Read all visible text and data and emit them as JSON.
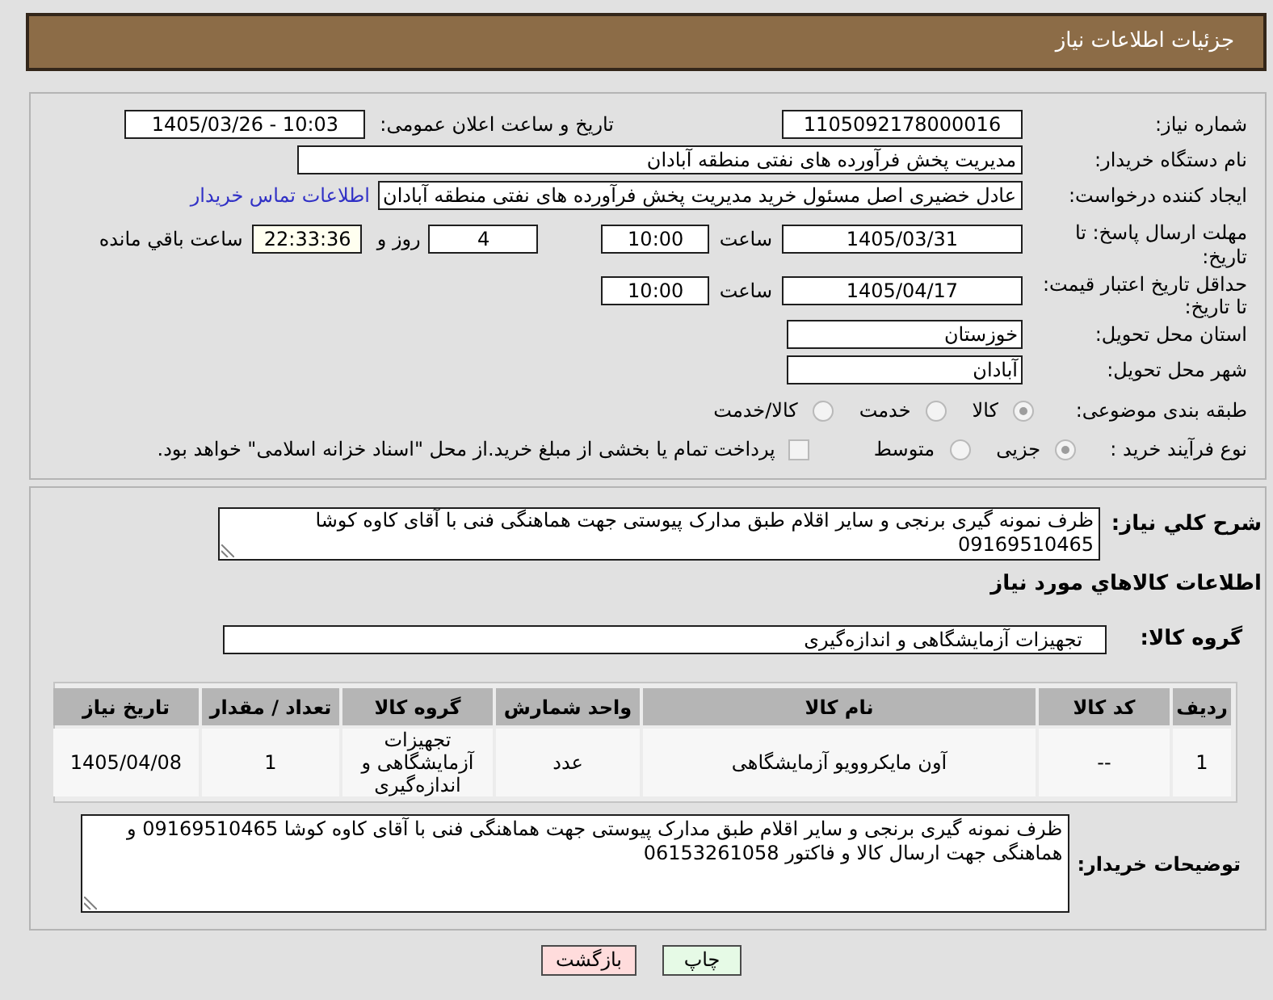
{
  "header": {
    "title": "جزئیات اطلاعات نیاز"
  },
  "need": {
    "number_label": "شماره نیاز:",
    "number": "1105092178000016",
    "announce_label": "تاریخ و ساعت اعلان عمومی:",
    "announce": "1405/03/26 - 10:03"
  },
  "buyer": {
    "label": "نام دستگاه خریدار:",
    "value": "مدیریت پخش فرآورده های نفتی منطقه آبادان"
  },
  "requester": {
    "label": "ایجاد کننده درخواست:",
    "value": "عادل خضیری اصل مسئول خرید مدیریت پخش فرآورده های نفتی منطقه آبادان",
    "link": "اطلاعات تماس خریدار"
  },
  "response_deadline": {
    "label": "مهلت ارسال پاسخ: تا تاریخ:",
    "date": "1405/03/31",
    "time_label": "ساعت",
    "time": "10:00",
    "days": "4",
    "days_label": "روز و",
    "remaining": "22:33:36",
    "remaining_label": "ساعت باقي مانده"
  },
  "price_validity": {
    "label": "حداقل تاریخ اعتبار قیمت: تا تاریخ:",
    "date": "1405/04/17",
    "time_label": "ساعت",
    "time": "10:00"
  },
  "delivery": [
    {
      "label": "استان محل تحویل:",
      "value": "خوزستان"
    },
    {
      "label": "شهر محل تحویل:",
      "value": "آبادان"
    }
  ],
  "category": {
    "label": "طبقه بندی موضوعی:",
    "options": [
      {
        "label": "کالا",
        "selected": true
      },
      {
        "label": "خدمت",
        "selected": false
      },
      {
        "label": "کالا/خدمت",
        "selected": false
      }
    ]
  },
  "purchase_type": {
    "label": "نوع فرآیند خرید :",
    "options": [
      {
        "label": "جزیی",
        "selected": true
      },
      {
        "label": "متوسط",
        "selected": false
      }
    ],
    "treasury_payment": {
      "label": "پرداخت تمام یا بخشی از مبلغ خرید.از محل \"اسناد خزانه اسلامی\" خواهد بود.",
      "checked": false
    }
  },
  "description": {
    "label": "شرح کلي نیاز:",
    "value": "ظرف نمونه گیری برنجی و سایر اقلام طبق مدارک پیوستی جهت هماهنگی فنی با آقای کاوه کوشا 09169510465"
  },
  "goods": {
    "heading": "اطلاعات کالاهاي مورد نیاز",
    "group_label": "گروه کالا:",
    "group": "تجهیزات آزمایشگاهی و اندازه‌گیری"
  },
  "table": {
    "columns": [
      "ردیف",
      "کد کالا",
      "نام کالا",
      "واحد شمارش",
      "گروه کالا",
      "تعداد / مقدار",
      "تاریخ نیاز"
    ],
    "rows": [
      [
        "1",
        "--",
        "آون مایکروویو آزمایشگاهی",
        "عدد",
        "تجهیزات آزمایشگاهی و اندازه‌گیری",
        "1",
        "1405/04/08"
      ]
    ]
  },
  "buyer_notes": {
    "label": "توضیحات خریدار:",
    "value": "ظرف نمونه گیری برنجی و سایر اقلام طبق مدارک پیوستی جهت هماهنگی فنی با آقای کاوه کوشا 09169510465 و هماهنگی جهت ارسال کالا و فاکتور 06153261058"
  },
  "buttons": [
    {
      "label": "چاپ",
      "kind": "print"
    },
    {
      "label": "بازگشت",
      "kind": "back"
    }
  ]
}
